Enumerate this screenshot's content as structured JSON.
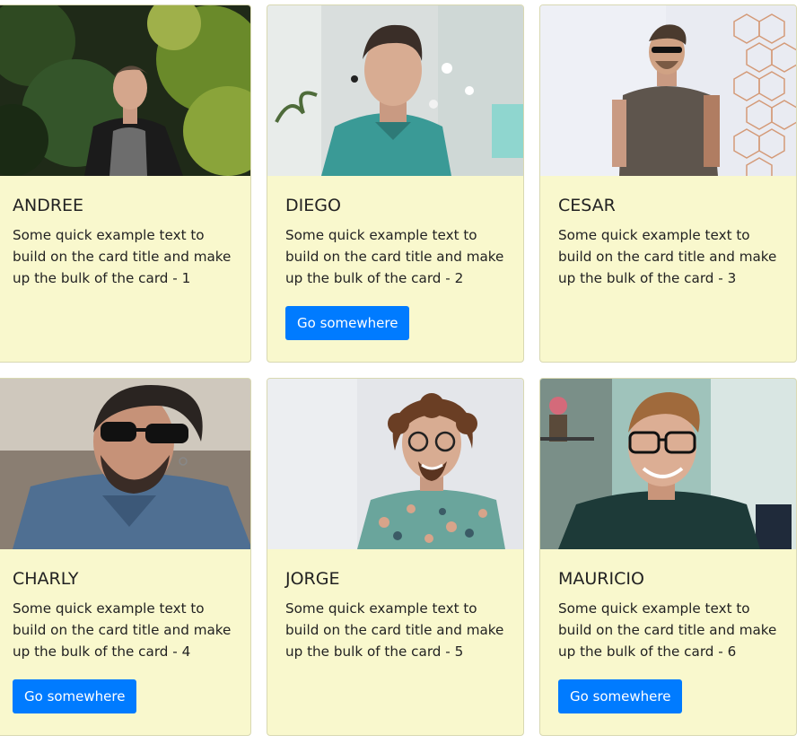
{
  "cards": [
    {
      "title": "ANDREE",
      "text": "Some quick example text to build on the card title and make up the bulk of the card - 1",
      "button": ""
    },
    {
      "title": "DIEGO",
      "text": "Some quick example text to build on the card title and make up the bulk of the card - 2",
      "button": "Go somewhere"
    },
    {
      "title": "CESAR",
      "text": "Some quick example text to build on the card title and make up the bulk of the card - 3",
      "button": ""
    },
    {
      "title": "CHARLY",
      "text": "Some quick example text to build on the card title and make up the bulk of the card - 4",
      "button": "Go somewhere"
    },
    {
      "title": "JORGE",
      "text": "Some quick example text to build on the card title and make up the bulk of the card - 5",
      "button": ""
    },
    {
      "title": "MAURICIO",
      "text": "Some quick example text to build on the card title and make up the bulk of the card - 6",
      "button": "Go somewhere"
    }
  ],
  "colors": {
    "card_background": "#f9f8cd",
    "button_background": "#007bff",
    "button_text": "#ffffff",
    "text": "#222222"
  }
}
